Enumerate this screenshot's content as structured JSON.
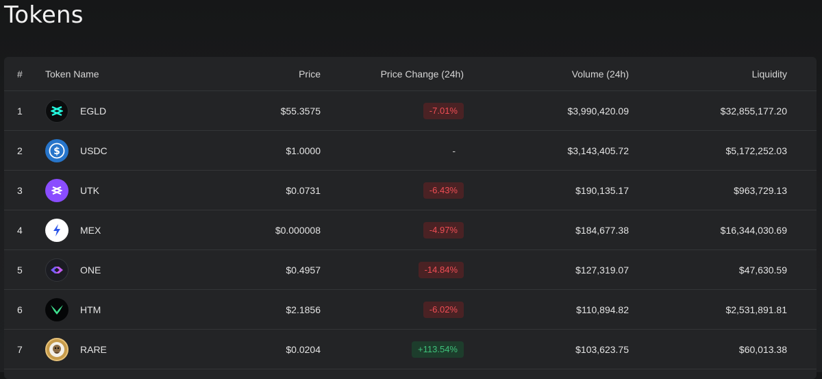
{
  "page": {
    "title": "Tokens"
  },
  "table": {
    "headers": {
      "rank": "#",
      "name": "Token Name",
      "price": "Price",
      "change": "Price Change (24h)",
      "volume": "Volume (24h)",
      "liquidity": "Liquidity"
    },
    "rows": [
      {
        "rank": "1",
        "name": "EGLD",
        "icon": "egld-icon",
        "price": "$55.3575",
        "change": "-7.01%",
        "change_dir": "neg",
        "volume": "$3,990,420.09",
        "liquidity": "$32,855,177.20"
      },
      {
        "rank": "2",
        "name": "USDC",
        "icon": "usdc-icon",
        "price": "$1.0000",
        "change": "-",
        "change_dir": "none",
        "volume": "$3,143,405.72",
        "liquidity": "$5,172,252.03"
      },
      {
        "rank": "3",
        "name": "UTK",
        "icon": "utk-icon",
        "price": "$0.0731",
        "change": "-6.43%",
        "change_dir": "neg",
        "volume": "$190,135.17",
        "liquidity": "$963,729.13"
      },
      {
        "rank": "4",
        "name": "MEX",
        "icon": "mex-icon",
        "price": "$0.000008",
        "change": "-4.97%",
        "change_dir": "neg",
        "volume": "$184,677.38",
        "liquidity": "$16,344,030.69"
      },
      {
        "rank": "5",
        "name": "ONE",
        "icon": "one-icon",
        "price": "$0.4957",
        "change": "-14.84%",
        "change_dir": "neg",
        "volume": "$127,319.07",
        "liquidity": "$47,630.59"
      },
      {
        "rank": "6",
        "name": "HTM",
        "icon": "htm-icon",
        "price": "$2.1856",
        "change": "-6.02%",
        "change_dir": "neg",
        "volume": "$110,894.82",
        "liquidity": "$2,531,891.81"
      },
      {
        "rank": "7",
        "name": "RARE",
        "icon": "rare-icon",
        "price": "$0.0204",
        "change": "+113.54%",
        "change_dir": "pos",
        "volume": "$103,623.75",
        "liquidity": "$60,013.38"
      }
    ]
  },
  "colors": {
    "negative": "#f04e55",
    "positive": "#3fc17a",
    "background": "#1d1e20",
    "card": "#232426"
  }
}
